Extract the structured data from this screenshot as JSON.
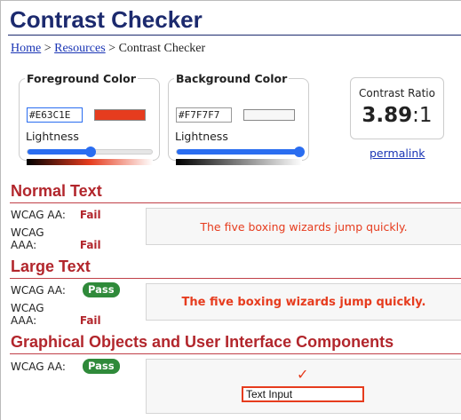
{
  "page": {
    "title": "Contrast Checker",
    "breadcrumb": {
      "home": "Home",
      "sep1": " > ",
      "resources": "Resources",
      "sep2": " > ",
      "current": "Contrast Checker"
    }
  },
  "foreground": {
    "legend": "Foreground Color",
    "hex": "#E63C1E",
    "swatch_color": "#e63c1e",
    "lightness_label": "Lightness",
    "lightness_percent": 50
  },
  "background": {
    "legend": "Background Color",
    "hex": "#F7F7F7",
    "swatch_color": "#f7f7f7",
    "lightness_label": "Lightness",
    "lightness_percent": 97
  },
  "ratio": {
    "label": "Contrast Ratio",
    "value": "3.89",
    "suffix": ":1",
    "permalink": "permalink"
  },
  "normal_text": {
    "title": "Normal Text",
    "aa_label": "WCAG AA:",
    "aa_result": "Fail",
    "aaa_label": "WCAG AAA:",
    "aaa_result": "Fail",
    "sample": "The five boxing wizards jump quickly."
  },
  "large_text": {
    "title": "Large Text",
    "aa_label": "WCAG AA:",
    "aa_result": "Pass",
    "aaa_label": "WCAG AAA:",
    "aaa_result": "Fail",
    "sample": "The five boxing wizards jump quickly."
  },
  "graphics": {
    "title": "Graphical Objects and User Interface Components",
    "aa_label": "WCAG AA:",
    "aa_result": "Pass",
    "icon": "checkmark-icon",
    "input_value": "Text Input"
  },
  "colors": {
    "fail": "#b2262c",
    "pass": "#2f8a3a",
    "heading": "#1c2a6e",
    "slider": "#2a6df0"
  }
}
